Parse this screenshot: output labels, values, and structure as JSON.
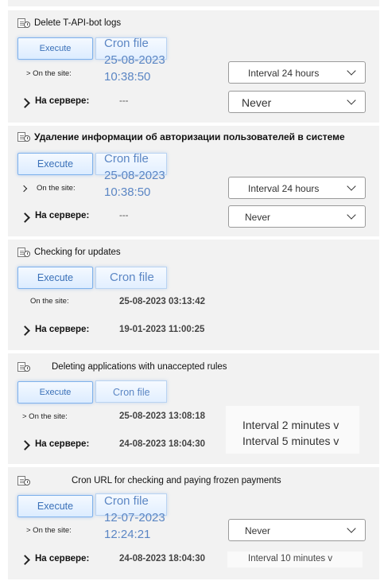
{
  "tasks": [
    {
      "title": "Delete T-API-bot logs",
      "execute_label": "Execute",
      "cron_label": "Cron file",
      "cron_date": "25-08-2023",
      "cron_time": "10:38:50",
      "site_label": "> On the site:",
      "server_label": "На сервере:",
      "server_value": "---",
      "site_interval": "Interval 24 hours",
      "server_interval": "Never"
    },
    {
      "title": "Удаление информации об авторизации пользователей в системе",
      "execute_label": "Execute",
      "cron_label": "Cron file",
      "cron_date": "25-08-2023",
      "cron_time": "10:38:50",
      "site_label": "On the site:",
      "server_label": "На сервере:",
      "server_value": "---",
      "site_interval": "Interval 24 hours",
      "server_interval": "Never"
    },
    {
      "title": "Checking for updates",
      "execute_label": "Execute",
      "cron_label": "Cron file",
      "site_label": "On the site:",
      "site_value": "25-08-2023 03:13:42",
      "server_label": "На сервере:",
      "server_value": "19-01-2023 11:00:25"
    },
    {
      "title": "Deleting applications with unaccepted rules",
      "execute_label": "Execute",
      "cron_label": "Cron file",
      "site_label": "> On the site:",
      "site_value": "25-08-2023 13:08:18",
      "server_label": "На сервере:",
      "server_value": "24-08-2023 18:04:30",
      "interval_1": "Interval 2 minutes v",
      "interval_2": "Interval 5 minutes v"
    },
    {
      "title": "Cron URL for checking and paying frozen payments",
      "execute_label": "Execute",
      "cron_label": "Cron file",
      "cron_date": "12-07-2023",
      "cron_time": "12:24:21",
      "site_label": "> On the site:",
      "site_interval": "Never",
      "server_label": "На сервере:",
      "server_value": "24-08-2023 18:04:30",
      "server_interval": "Interval 10 minutes v"
    }
  ]
}
